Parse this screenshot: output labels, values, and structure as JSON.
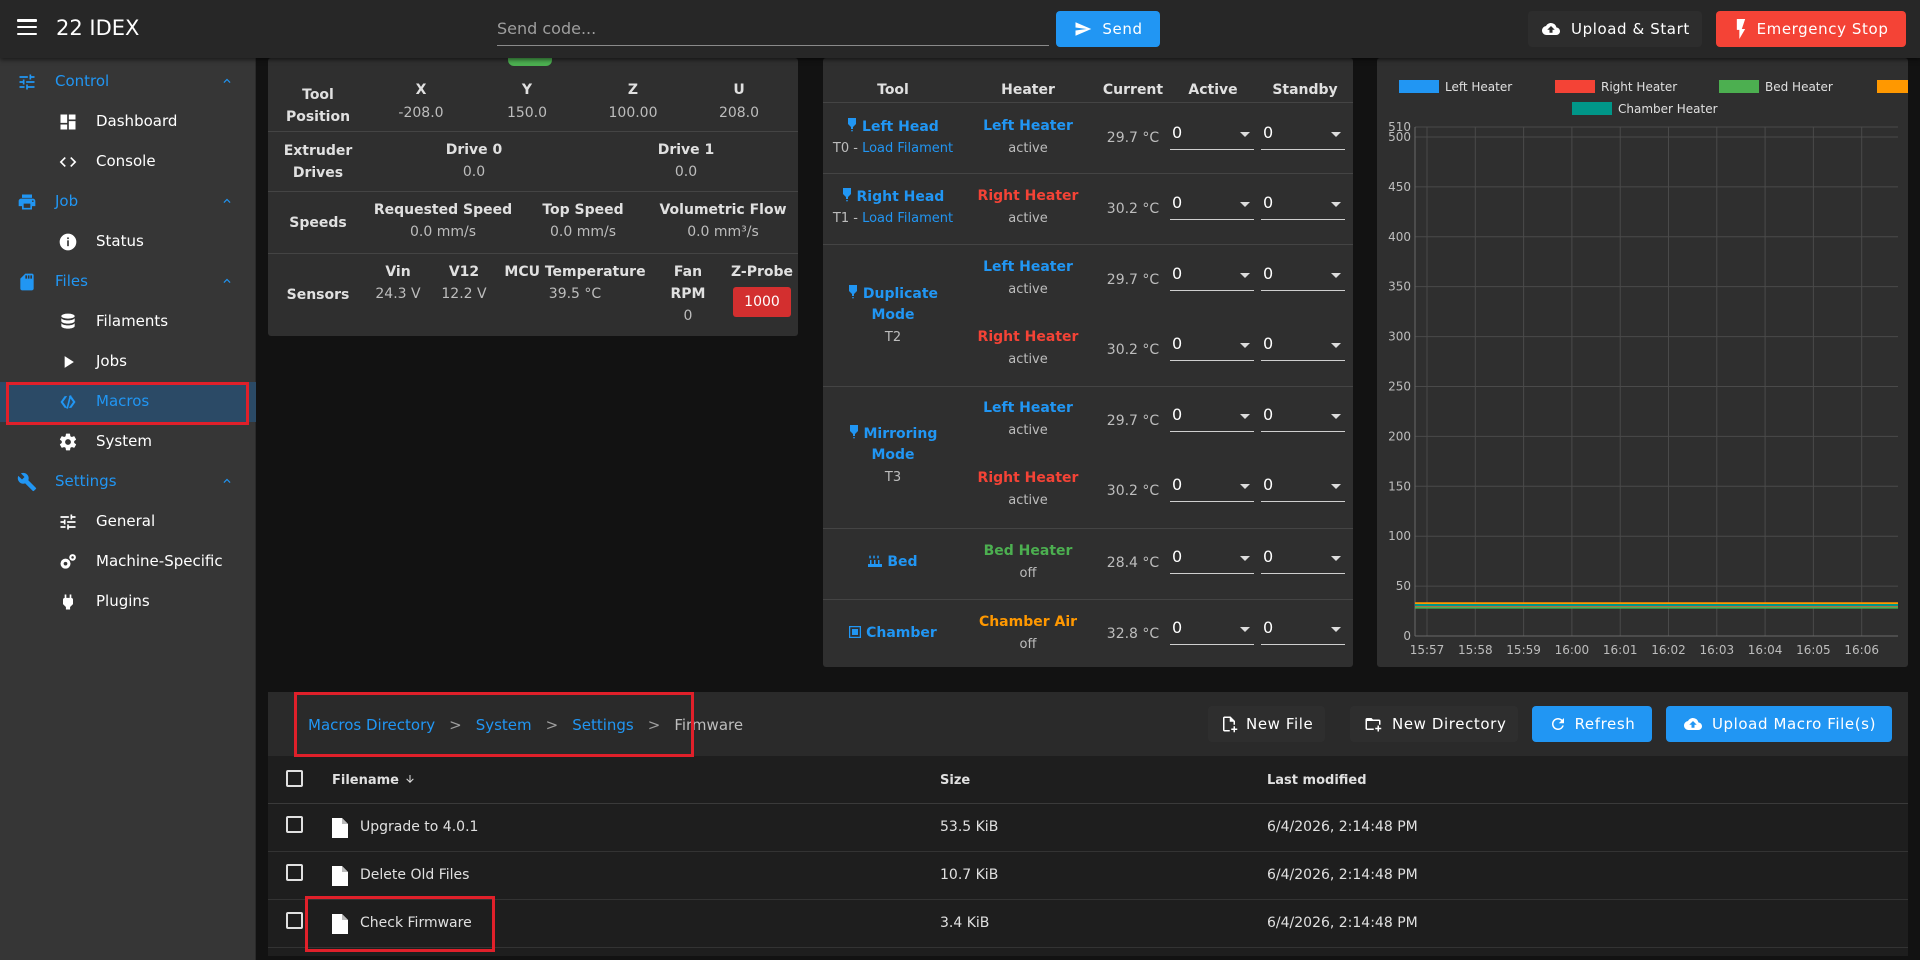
{
  "header": {
    "title": "22 IDEX",
    "code_placeholder": "Send code...",
    "send_label": "Send",
    "upload_start_label": "Upload & Start",
    "emergency_stop_label": "Emergency Stop"
  },
  "sidebar": {
    "groups": [
      {
        "label": "Control",
        "icon": "tune-icon",
        "items": [
          "Dashboard",
          "Console"
        ]
      },
      {
        "label": "Job",
        "icon": "printer-icon",
        "items": [
          "Status"
        ]
      },
      {
        "label": "Files",
        "icon": "sd-card-icon",
        "items": [
          "Filaments",
          "Jobs",
          "Macros",
          "System"
        ]
      },
      {
        "label": "Settings",
        "icon": "wrench-icon",
        "items": [
          "General",
          "Machine-Specific",
          "Plugins"
        ]
      }
    ],
    "active_item": "Macros"
  },
  "status_card": {
    "tool_position": {
      "label": "Tool Position",
      "axes": [
        {
          "name": "X",
          "value": "-208.0"
        },
        {
          "name": "Y",
          "value": "150.0"
        },
        {
          "name": "Z",
          "value": "100.00"
        },
        {
          "name": "U",
          "value": "208.0"
        }
      ]
    },
    "extruder": {
      "label": "Extruder Drives",
      "label_line1": "Extruder",
      "label_line2": "Drives",
      "drives": [
        {
          "name": "Drive 0",
          "value": "0.0"
        },
        {
          "name": "Drive 1",
          "value": "0.0"
        }
      ]
    },
    "speeds": {
      "label": "Speeds",
      "items": [
        {
          "name": "Requested Speed",
          "value": "0.0 mm/s"
        },
        {
          "name": "Top Speed",
          "value": "0.0 mm/s"
        },
        {
          "name": "Volumetric Flow",
          "value": "0.0 mm³/s"
        }
      ]
    },
    "sensors": {
      "label": "Sensors",
      "vin_label": "Vin",
      "vin_value": "24.3 V",
      "v12_label": "V12",
      "v12_value": "12.2 V",
      "mcu_label": "MCU Temperature",
      "mcu_value": "39.5 °C",
      "fan_label_1": "Fan",
      "fan_label_2": "RPM",
      "fan_value": "0",
      "zprobe_label": "Z-Probe",
      "zprobe_value": "1000"
    }
  },
  "tools_card": {
    "headers": [
      "Tool",
      "Heater",
      "Current",
      "Active",
      "Standby"
    ],
    "rows": [
      {
        "tool": "Left Head",
        "sub_prefix": "T0 - ",
        "sub_link": "Load Filament",
        "heaters": [
          {
            "name": "Left Heater",
            "state": "active",
            "current": "29.7 °C",
            "active": "0",
            "standby": "0"
          }
        ]
      },
      {
        "tool": "Right Head",
        "sub_prefix": "T1 - ",
        "sub_link": "Load Filament",
        "heaters": [
          {
            "name": "Right Heater",
            "state": "active",
            "current": "30.2 °C",
            "active": "0",
            "standby": "0"
          }
        ]
      },
      {
        "tool_line1": "Duplicate",
        "tool_line2": "Mode",
        "sub": "T2",
        "heaters": [
          {
            "name": "Left Heater",
            "state": "active",
            "current": "29.7 °C",
            "active": "0",
            "standby": "0"
          },
          {
            "name": "Right Heater",
            "state": "active",
            "current": "30.2 °C",
            "active": "0",
            "standby": "0"
          }
        ]
      },
      {
        "tool_line1": "Mirroring",
        "tool_line2": "Mode",
        "sub": "T3",
        "heaters": [
          {
            "name": "Left Heater",
            "state": "active",
            "current": "29.7 °C",
            "active": "0",
            "standby": "0"
          },
          {
            "name": "Right Heater",
            "state": "active",
            "current": "30.2 °C",
            "active": "0",
            "standby": "0"
          }
        ]
      },
      {
        "tool": "Bed",
        "heaters": [
          {
            "name": "Bed Heater",
            "state": "off",
            "current": "28.4 °C",
            "active": "0",
            "standby": "0"
          }
        ]
      },
      {
        "tool": "Chamber",
        "heaters": [
          {
            "name": "Chamber Air",
            "state": "off",
            "current": "32.8 °C",
            "active": "0",
            "standby": "0"
          }
        ]
      }
    ]
  },
  "colors": {
    "accent": "#2196f3",
    "left_heater": "#2196f3",
    "right_heater": "#f44336",
    "bed_heater": "#4caf50",
    "chamber_air": "#ff9800",
    "chamber_heater": "#009688"
  },
  "chart_data": {
    "type": "line",
    "legend": [
      "Left Heater",
      "Right Heater",
      "Bed Heater",
      "Chamber Air",
      "Chamber Heater"
    ],
    "x": [
      "15:57",
      "15:58",
      "15:59",
      "16:00",
      "16:01",
      "16:02",
      "16:03",
      "16:04",
      "16:05",
      "16:06"
    ],
    "ylim": [
      0,
      510
    ],
    "yticks": [
      0,
      50,
      100,
      150,
      200,
      250,
      300,
      350,
      400,
      450,
      500,
      510
    ],
    "series": [
      {
        "name": "Left Heater",
        "values": [
          29.7,
          29.7,
          29.7,
          29.7,
          29.7,
          29.7,
          29.7,
          29.7,
          29.7,
          29.7
        ]
      },
      {
        "name": "Right Heater",
        "values": [
          30.2,
          30.2,
          30.2,
          30.2,
          30.2,
          30.2,
          30.2,
          30.2,
          30.2,
          30.2
        ]
      },
      {
        "name": "Bed Heater",
        "values": [
          28.4,
          28.4,
          28.4,
          28.4,
          28.4,
          28.4,
          28.4,
          28.4,
          28.4,
          28.4
        ]
      },
      {
        "name": "Chamber Air",
        "values": [
          32.8,
          32.8,
          32.8,
          32.8,
          32.8,
          32.8,
          32.8,
          32.8,
          32.8,
          32.8
        ]
      },
      {
        "name": "Chamber Heater",
        "values": [
          31.0,
          31.0,
          31.0,
          31.0,
          31.0,
          31.0,
          31.0,
          31.0,
          31.0,
          31.0
        ]
      }
    ],
    "grid": true,
    "legend_position": "top"
  },
  "files": {
    "breadcrumb": [
      "Macros Directory",
      "System",
      "Settings",
      "Firmware"
    ],
    "new_file_label": "New File",
    "new_directory_label": "New Directory",
    "refresh_label": "Refresh",
    "upload_label": "Upload Macro File(s)",
    "columns": {
      "filename": "Filename",
      "size": "Size",
      "modified": "Last modified"
    },
    "rows": [
      {
        "name": "Upgrade to 4.0.1",
        "size": "53.5 KiB",
        "modified": "6/4/2026, 2:14:48 PM"
      },
      {
        "name": "Delete Old Files",
        "size": "10.7 KiB",
        "modified": "6/4/2026, 2:14:48 PM"
      },
      {
        "name": "Check Firmware",
        "size": "3.4 KiB",
        "modified": "6/4/2026, 2:14:48 PM"
      }
    ]
  }
}
